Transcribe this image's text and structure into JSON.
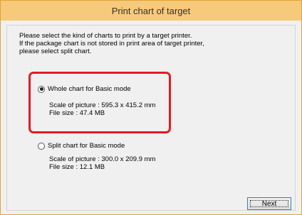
{
  "window": {
    "title": "Print chart of target"
  },
  "intro": {
    "line1": "Please select the kind of charts to print by a target printer.",
    "line2": "If the package chart is not stored in print area of target printer,",
    "line3": "please select split chart."
  },
  "options": [
    {
      "label": "Whole chart for Basic mode",
      "selected": true,
      "scale": "Scale of picture :  595.3 x  415.2 mm",
      "size": "File size :  47.4 MB"
    },
    {
      "label": "Split chart for Basic mode",
      "selected": false,
      "scale": "Scale of picture :  300.0 x  209.9 mm",
      "size": "File size :  12.1 MB"
    }
  ],
  "buttons": {
    "next": "Next"
  },
  "colors": {
    "title_bar": "#f7c97b",
    "highlight": "#e31b23"
  }
}
